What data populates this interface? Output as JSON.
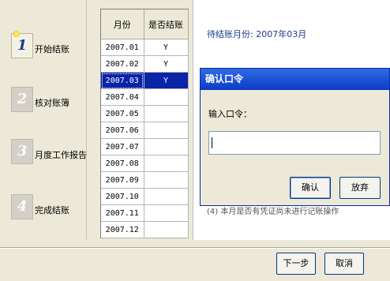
{
  "steps": [
    {
      "num": "1",
      "label": "开始结账",
      "active": true
    },
    {
      "num": "2",
      "label": "核对账簿",
      "active": false
    },
    {
      "num": "3",
      "label": "月度工作报告",
      "active": false
    },
    {
      "num": "4",
      "label": "完成结账",
      "active": false
    }
  ],
  "table": {
    "headers": [
      "月份",
      "是否结账"
    ],
    "rows": [
      {
        "month": "2007.01",
        "closed": "Y"
      },
      {
        "month": "2007.02",
        "closed": "Y"
      },
      {
        "month": "2007.03",
        "closed": "Y"
      },
      {
        "month": "2007.04",
        "closed": ""
      },
      {
        "month": "2007.05",
        "closed": ""
      },
      {
        "month": "2007.06",
        "closed": ""
      },
      {
        "month": "2007.07",
        "closed": ""
      },
      {
        "month": "2007.08",
        "closed": ""
      },
      {
        "month": "2007.09",
        "closed": ""
      },
      {
        "month": "2007.10",
        "closed": ""
      },
      {
        "month": "2007.11",
        "closed": ""
      },
      {
        "month": "2007.12",
        "closed": ""
      }
    ],
    "selected_month": "2007.03"
  },
  "info": {
    "pending_month": "待结账月份: 2007年03月",
    "hint_partial": "(4) 本月是否有凭证尚未进行记账操作"
  },
  "dialog": {
    "title": "确认口令",
    "prompt": "输入口令：",
    "password_value": "",
    "ok_label": "确认",
    "cancel_label": "放弃"
  },
  "footer": {
    "next_label": "下一步",
    "cancel_label": "取消"
  },
  "colors": {
    "selection": "#0a24a8",
    "title_bar": "#0b3cc8",
    "accent_text": "#1e3a8a"
  }
}
